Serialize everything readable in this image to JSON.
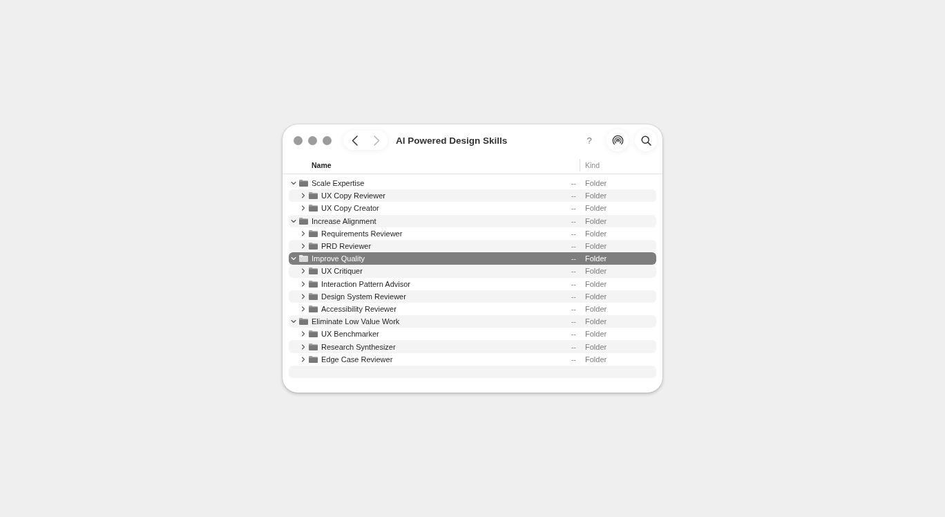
{
  "window": {
    "title": "AI Powered Design Skills"
  },
  "toolbar": {
    "navigation": [
      {
        "kind": "back",
        "disabled": false
      },
      {
        "kind": "forward",
        "disabled": true
      }
    ],
    "help": "?"
  },
  "columns": [
    {
      "label": "Name",
      "selected": true
    },
    {
      "label": "Kind",
      "selected": false
    }
  ],
  "items": [
    {
      "name": "Scale Expertise",
      "column_2": "--",
      "kind_label": "Folder",
      "expanded": true,
      "selected": false,
      "children": [
        {
          "name": "UX Copy Reviewer",
          "column_2": "--",
          "kind_label": "Folder",
          "expanded": false,
          "selected": false
        },
        {
          "name": "UX Copy Creator",
          "column_2": "--",
          "kind_label": "Folder",
          "expanded": false,
          "selected": false
        }
      ]
    },
    {
      "name": "Increase Alignment",
      "column_2": "--",
      "kind_label": "Folder",
      "expanded": true,
      "selected": false,
      "children": [
        {
          "name": "Requirements Reviewer",
          "column_2": "--",
          "kind_label": "Folder",
          "expanded": false,
          "selected": false
        },
        {
          "name": "PRD Reviewer",
          "column_2": "--",
          "kind_label": "Folder",
          "expanded": false,
          "selected": false
        }
      ]
    },
    {
      "name": "Improve Quality",
      "column_2": "--",
      "kind_label": "Folder",
      "expanded": true,
      "selected": true,
      "children": [
        {
          "name": "UX Critiquer",
          "column_2": "--",
          "kind_label": "Folder",
          "expanded": false,
          "selected": false
        },
        {
          "name": "Interaction Pattern Advisor",
          "column_2": "--",
          "kind_label": "Folder",
          "expanded": false,
          "selected": false
        },
        {
          "name": "Design System Reviewer",
          "column_2": "--",
          "kind_label": "Folder",
          "expanded": false,
          "selected": false
        },
        {
          "name": "Accessibility Reviewer",
          "column_2": "--",
          "kind_label": "Folder",
          "expanded": false,
          "selected": false
        }
      ]
    },
    {
      "name": "Eliminate Low Value Work",
      "column_2": "--",
      "kind_label": "Folder",
      "expanded": true,
      "selected": false,
      "children": [
        {
          "name": "UX Benchmarker",
          "column_2": "--",
          "kind_label": "Folder",
          "expanded": false,
          "selected": false
        },
        {
          "name": "Research Synthesizer",
          "column_2": "--",
          "kind_label": "Folder",
          "expanded": false,
          "selected": false
        },
        {
          "name": "Edge Case Reviewer",
          "column_2": "--",
          "kind_label": "Folder",
          "expanded": false,
          "selected": false
        }
      ]
    }
  ]
}
